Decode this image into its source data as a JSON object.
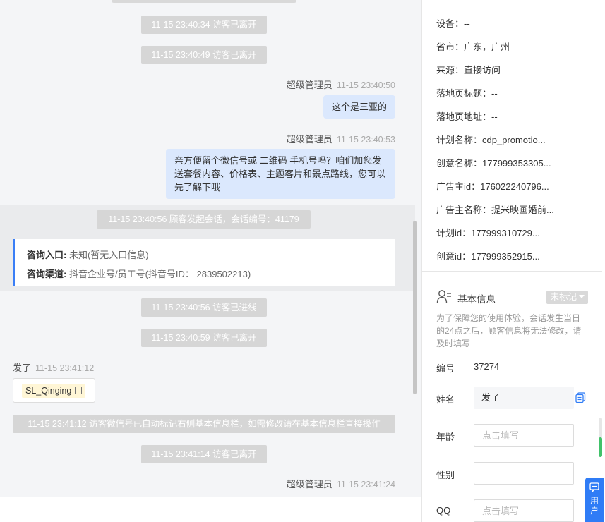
{
  "chat": {
    "events": [
      "11-15 23:40:34 访客已离开",
      "11-15 23:40:49 访客已离开",
      "11-15 23:40:56 顾客发起会话，会话编号：41179",
      "11-15 23:40:56 访客已进线",
      "11-15 23:40:59 访客已离开",
      "11-15 23:41:12 访客微信号已自动标记右侧基本信息栏，如需修改请在基本信息栏直接操作",
      "11-15 23:41:14 访客已离开"
    ],
    "messages": [
      {
        "sender": "超级管理员",
        "time": "11-15 23:40:50",
        "text": "这个是三亚的"
      },
      {
        "sender": "超级管理员",
        "time": "11-15 23:40:53",
        "text": "亲方便留个微信号或 二维码 手机号吗？咱们加您发送套餐内容、价格表、主题客片和景点路线，您可以先了解下哦"
      },
      {
        "sender": "超级管理员",
        "time": "11-15 23:41:24"
      }
    ],
    "inquiry_card": {
      "entry_label": "咨询入口:",
      "entry_value": "未知(暂无入口信息)",
      "channel_label": "咨询渠道:",
      "channel_value": "抖音企业号/员工号(抖音号ID： 2839502213)"
    },
    "visitor_message": {
      "sender": "发了",
      "time": "11-15 23:41:12",
      "tag": "SL_Qinging"
    }
  },
  "panel": {
    "details": [
      "设备：--",
      "省市：广东，广州",
      "来源：直接访问",
      "落地页标题：--",
      "落地页地址：--",
      "计划名称：cdp_promotio...",
      "创意名称：177999353305...",
      "广告主id：176022240796...",
      "广告主名称：提米映画婚前...",
      "计划id：177999310729...",
      "创意id：177999352915..."
    ],
    "basic_info": {
      "title": "基本信息",
      "tag_select": "未标记",
      "hint": "为了保障您的使用体验，会话发生当日的24点之后，顾客信息将无法修改，请及时填写",
      "id_label": "编号",
      "id_value": "37274",
      "name_label": "姓名",
      "name_value": "发了",
      "age_label": "年龄",
      "age_placeholder": "点击填写",
      "gender_label": "性别",
      "qq_label": "QQ",
      "qq_placeholder": "点击填写"
    },
    "float_button": "用户"
  },
  "colors": {
    "accent": "#3a7ef6",
    "bubble": "#dbe8fd",
    "pill": "#d6d6d6",
    "scroll_green": "#41c26a"
  }
}
